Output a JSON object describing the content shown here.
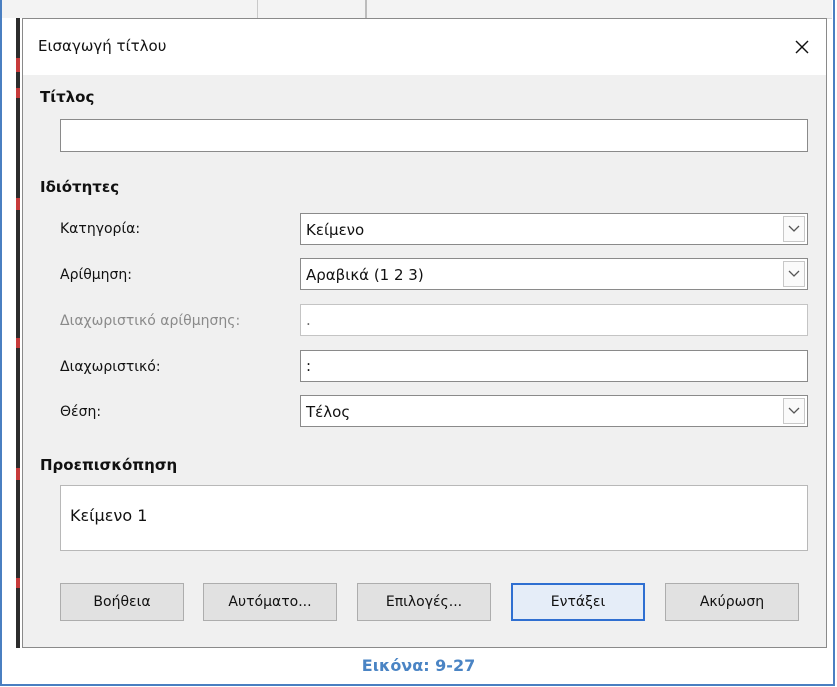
{
  "dialog": {
    "title": "Εισαγωγή τίτλου",
    "title_section": {
      "heading": "Τίτλος",
      "input_value": ""
    },
    "properties": {
      "heading": "Ιδιότητες",
      "category_label": "Κατηγορία:",
      "category_value": "Κείμενο",
      "numbering_label": "Αρίθμηση:",
      "numbering_value": "Αραβικά (1 2 3)",
      "numbering_separator_label": "Διαχωριστικό αρίθμησης:",
      "numbering_separator_value": ".",
      "separator_label": "Διαχωριστικό:",
      "separator_value": ":",
      "position_label": "Θέση:",
      "position_value": "Τέλος"
    },
    "preview": {
      "heading": "Προεπισκόπηση",
      "text": "Κείμενο 1"
    },
    "buttons": {
      "help": "Βοήθεια",
      "auto": "Αυτόματο...",
      "options": "Επιλογές...",
      "ok": "Εντάξει",
      "cancel": "Ακύρωση"
    }
  },
  "caption": "Εικόνα: 9-27",
  "colors": {
    "accent": "#2f6fd1",
    "caption": "#4a84c4",
    "frame": "#4a7fc1"
  }
}
